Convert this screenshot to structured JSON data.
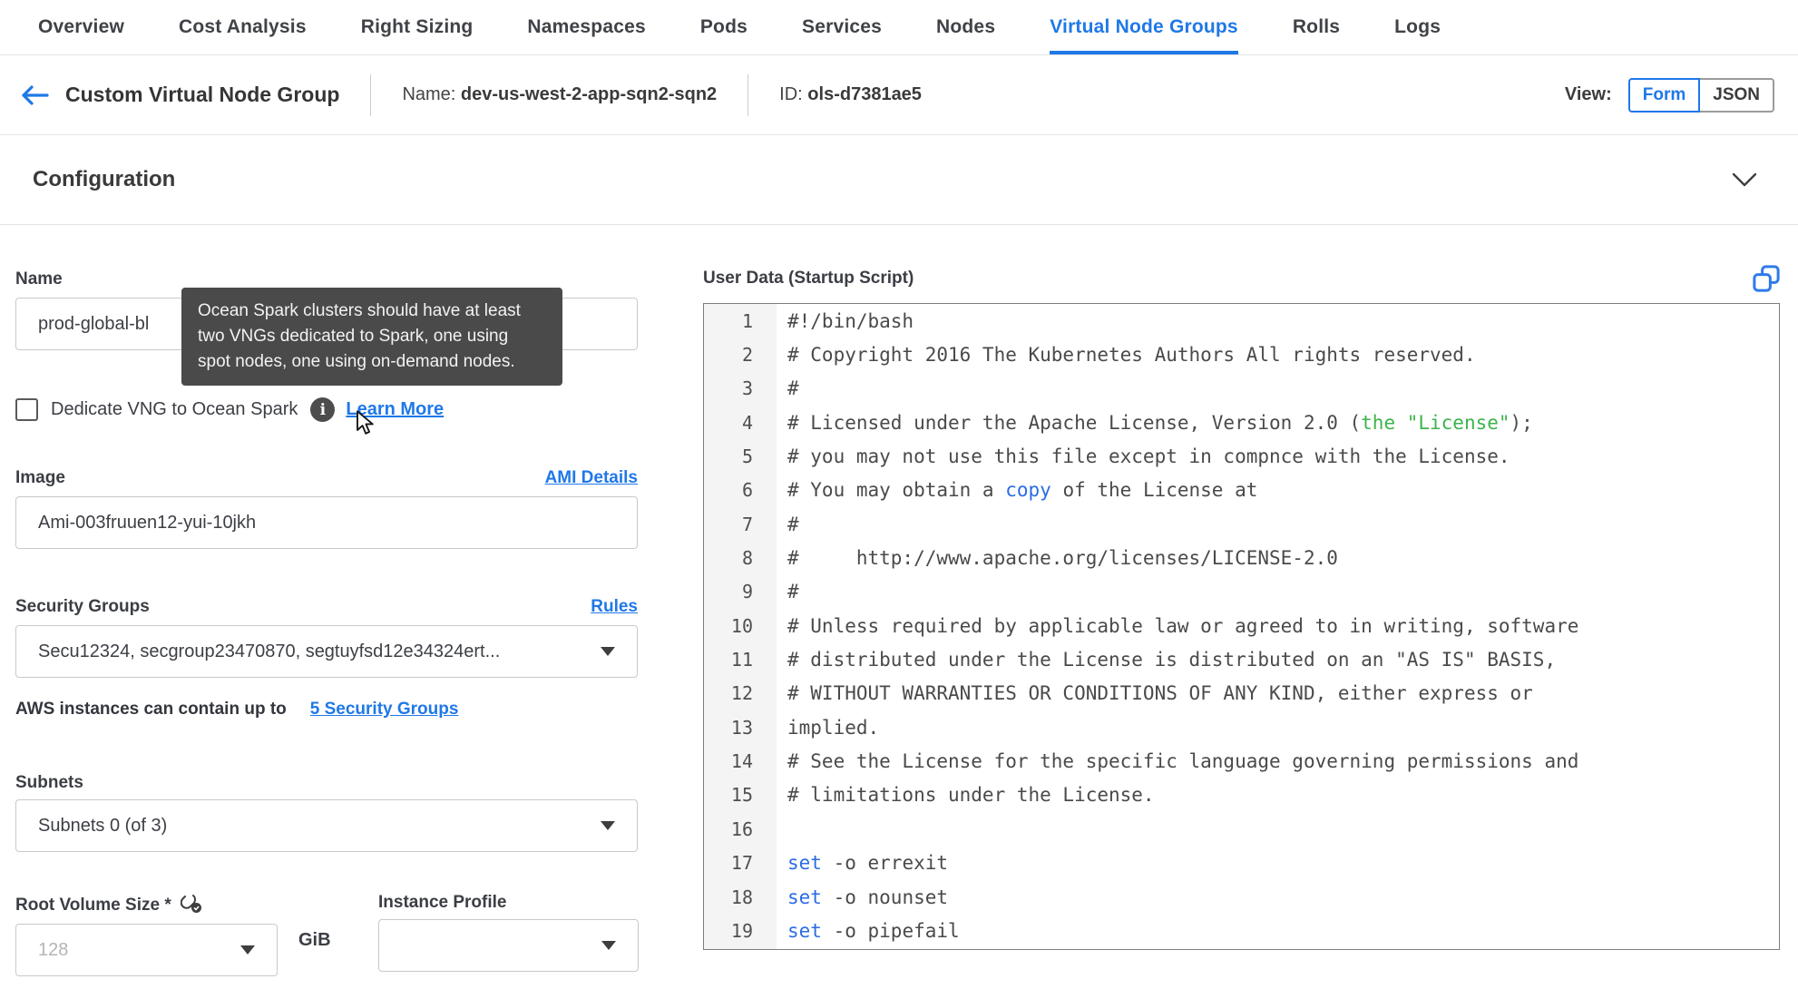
{
  "tabs": [
    {
      "label": "Overview",
      "active": false
    },
    {
      "label": "Cost Analysis",
      "active": false
    },
    {
      "label": "Right Sizing",
      "active": false
    },
    {
      "label": "Namespaces",
      "active": false
    },
    {
      "label": "Pods",
      "active": false
    },
    {
      "label": "Services",
      "active": false
    },
    {
      "label": "Nodes",
      "active": false
    },
    {
      "label": "Virtual Node Groups",
      "active": true
    },
    {
      "label": "Rolls",
      "active": false
    },
    {
      "label": "Logs",
      "active": false
    }
  ],
  "header": {
    "title": "Custom Virtual Node Group",
    "name_label": "Name:",
    "name_value": "dev-us-west-2-app-sqn2-sqn2",
    "id_label": "ID:",
    "id_value": "ols-d7381ae5",
    "view_label": "View:",
    "form_label": "Form",
    "json_label": "JSON"
  },
  "section": {
    "title": "Configuration"
  },
  "form": {
    "name_label": "Name",
    "name_value": "prod-global-bl",
    "tooltip_text": "Ocean Spark clusters should have at least\ntwo VNGs dedicated to Spark, one using\nspot nodes, one using on-demand nodes.",
    "dedicate_label": "Dedicate VNG to Ocean Spark",
    "learn_more_label": "Learn More",
    "image_label": "Image",
    "ami_details_label": "AMI Details",
    "image_value": "Ami-003fruuen12-yui-10jkh",
    "security_groups_label": "Security Groups",
    "rules_label": "Rules",
    "security_groups_value": "Secu12324, secgroup23470870, segtuyfsd12e34324ert...",
    "sg_hint_text": "AWS instances can contain up to",
    "sg_hint_link": "5 Security Groups",
    "subnets_label": "Subnets",
    "subnets_value": "Subnets 0 (of 3)",
    "root_volume_label": "Root Volume Size *",
    "root_volume_placeholder": "128",
    "root_volume_unit": "GiB",
    "instance_profile_label": "Instance Profile",
    "instance_profile_value": ""
  },
  "icons": {
    "info_glyph": "i"
  },
  "user_data": {
    "label": "User Data (Startup Script)",
    "lines": [
      [
        {
          "t": "#!/bin/bash"
        }
      ],
      [
        {
          "t": "# Copyright 2016 The Kubernetes Authors All rights reserved."
        }
      ],
      [
        {
          "t": "#"
        }
      ],
      [
        {
          "t": "# Licensed under the Apache License, Version 2.0 ("
        },
        {
          "t": "the \"License\"",
          "c": "green"
        },
        {
          "t": ");"
        }
      ],
      [
        {
          "t": "# you may not use this file except in compnce with the License."
        }
      ],
      [
        {
          "t": "# You may obtain a "
        },
        {
          "t": "copy",
          "c": "blue"
        },
        {
          "t": " of the License at"
        }
      ],
      [
        {
          "t": "#"
        }
      ],
      [
        {
          "t": "#     http://www.apache.org/licenses/LICENSE-2.0"
        }
      ],
      [
        {
          "t": "#"
        }
      ],
      [
        {
          "t": "# Unless required by applicable law or agreed to in writing, software"
        }
      ],
      [
        {
          "t": "# distributed under the License is distributed on an \"AS IS\" BASIS,"
        }
      ],
      [
        {
          "t": "# WITHOUT WARRANTIES OR CONDITIONS OF ANY KIND, either express or"
        }
      ],
      [
        {
          "t": "implied."
        }
      ],
      [
        {
          "t": "# See the License for the specific language governing permissions and"
        }
      ],
      [
        {
          "t": "# limitations under the License."
        }
      ],
      [],
      [
        {
          "t": "set",
          "c": "blue"
        },
        {
          "t": " -o errexit"
        }
      ],
      [
        {
          "t": "set",
          "c": "blue"
        },
        {
          "t": " -o nounset"
        }
      ],
      [
        {
          "t": "set",
          "c": "blue"
        },
        {
          "t": " -o pipefail"
        }
      ]
    ]
  },
  "colors": {
    "accent": "#1f78e8",
    "code_green": "#3db34c",
    "code_blue": "#2b6ce4",
    "tooltip_bg": "#4a4a4a"
  }
}
